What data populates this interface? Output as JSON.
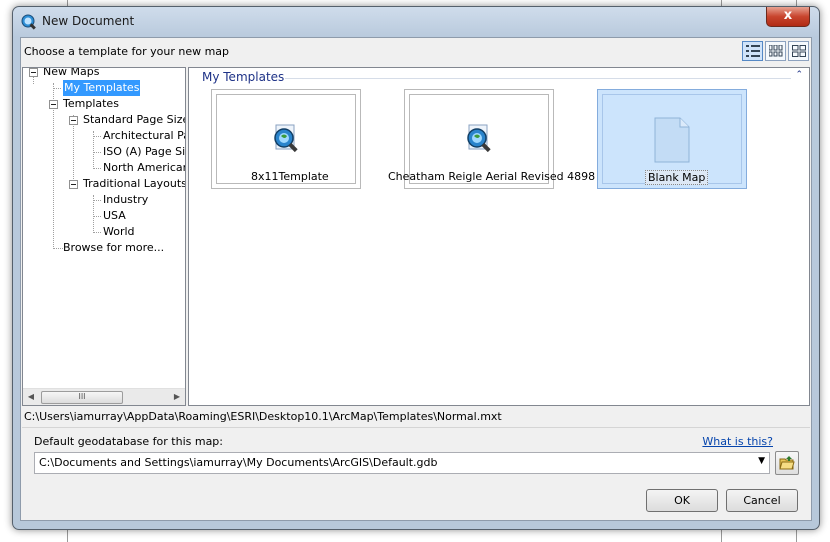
{
  "window": {
    "title": "New Document",
    "close_glyph": "x"
  },
  "header": {
    "prompt": "Choose a template for your new map"
  },
  "view_buttons": [
    {
      "name": "list-view-icon",
      "active": true
    },
    {
      "name": "small-thumbnails-icon",
      "active": false
    },
    {
      "name": "large-thumbnails-icon",
      "active": false
    }
  ],
  "tree": {
    "new_maps": "New Maps",
    "my_templates": "My Templates",
    "templates": "Templates",
    "standard_page_sizes": "Standard Page Sizes",
    "architectural": "Architectural Pag",
    "iso": "ISO (A) Page Siz",
    "north_american": "North American (",
    "traditional_layouts": "Traditional Layouts",
    "industry": "Industry",
    "usa": "USA",
    "world": "World",
    "browse": "Browse for more..."
  },
  "hscroll": {
    "grip": "III"
  },
  "group": {
    "header": "My Templates",
    "collapse_glyph": "⌃"
  },
  "templates": [
    {
      "label": "8x11Template",
      "icon": "arcmap-document-icon",
      "selected": false
    },
    {
      "label": "Cheatham Reigle Aerial Revised 4898",
      "icon": "arcmap-document-icon",
      "selected": false
    },
    {
      "label": "Blank Map",
      "icon": "blank-document-icon",
      "selected": true
    }
  ],
  "path": "C:\\Users\\iamurray\\AppData\\Roaming\\ESRI\\Desktop10.1\\ArcMap\\Templates\\Normal.mxt",
  "geodatabase": {
    "label": "Default geodatabase for this map:",
    "help": "What is this?",
    "value": "C:\\Documents and Settings\\iamurray\\My Documents\\ArcGIS\\Default.gdb",
    "dropdown_glyph": "▼"
  },
  "buttons": {
    "ok": "OK",
    "cancel": "Cancel"
  },
  "colors": {
    "selection": "#3399ff",
    "link": "#0645ad",
    "header_text": "#1e3287"
  }
}
